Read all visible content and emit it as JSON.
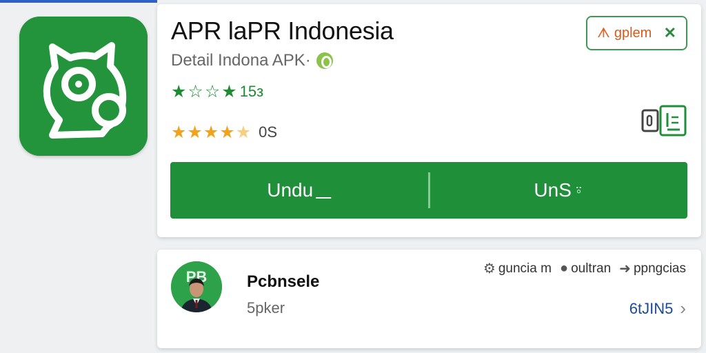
{
  "app": {
    "title": "APR laPR Indonesia",
    "subtitle": "Detail Indona APK·",
    "icon": "app-icon-green-cat-chat",
    "colors": {
      "primary": "#1f8f3a",
      "accent": "#f3a21b",
      "chip_text": "#d85a1d",
      "link": "#1a4b9a"
    }
  },
  "ratings": {
    "row1": {
      "stars": [
        "★",
        "☆",
        "☆",
        "★"
      ],
      "count": "15з"
    },
    "row2": {
      "stars": [
        "★",
        "★",
        "★",
        "★",
        "★"
      ],
      "value": 4.5,
      "count": "0S"
    }
  },
  "chip": {
    "icon": "ᗑ",
    "label": "gplem",
    "close": "✕"
  },
  "actions": {
    "primary": {
      "label": "Undu",
      "icon": "⎽"
    },
    "secondary": {
      "label": "UnS",
      "icon": "⍤"
    }
  },
  "developer": {
    "avatar_text": "PB",
    "name": "Pcbnsele",
    "subtitle": "5pker",
    "meta": [
      {
        "icon": "⚙",
        "label": "guncia m"
      },
      {
        "icon": "●",
        "label": "oultran"
      },
      {
        "icon": "➜",
        "label": "ppngcias"
      }
    ],
    "link_label": "6tJIN5",
    "link_icon": "›"
  }
}
